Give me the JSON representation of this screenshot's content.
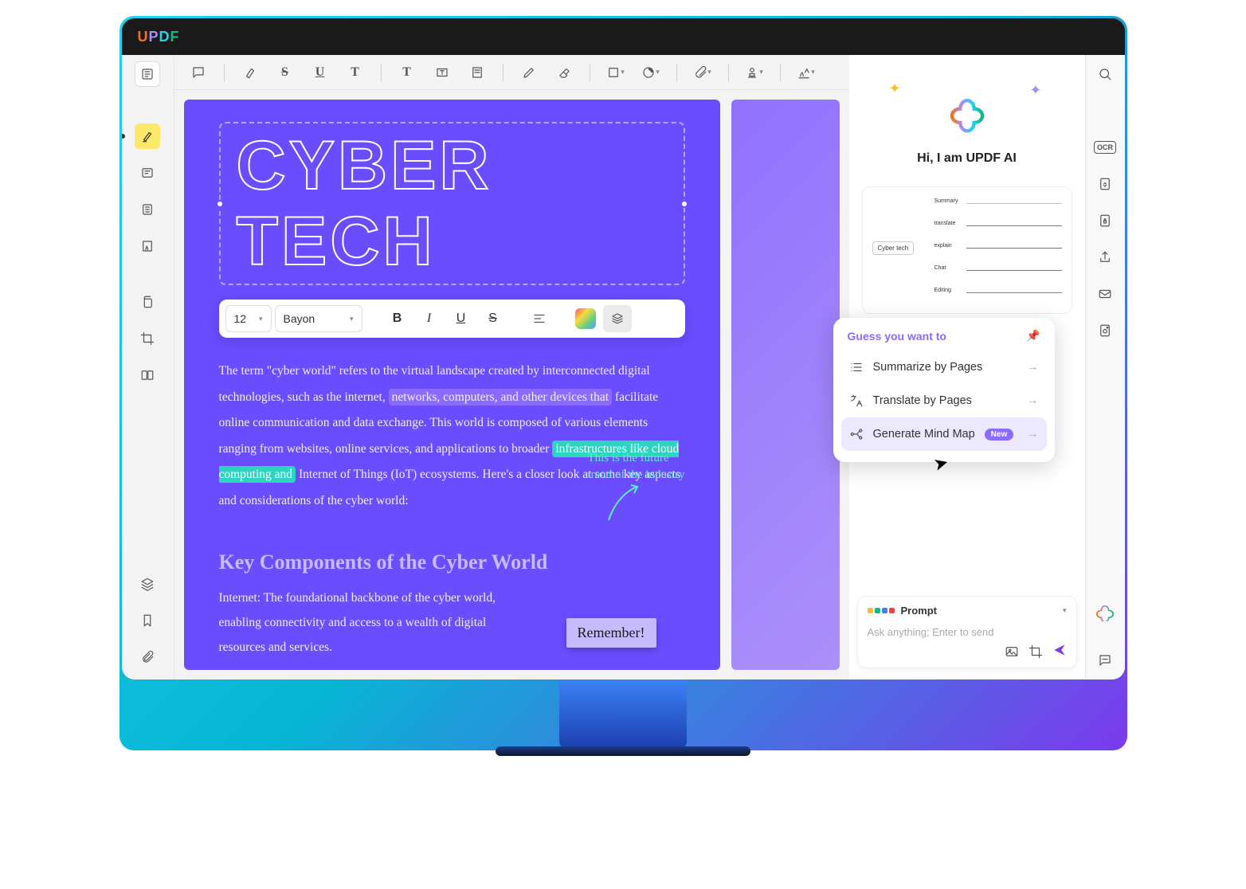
{
  "app_logo": "UPDF",
  "document": {
    "title": "CYBER TECH",
    "fontSize": "12",
    "fontName": "Bayon",
    "paragraph1_a": "The term \"cyber world\" refers to the virtual landscape created by interconnected digital technologies, such as the internet, ",
    "paragraph1_hl1": "networks, computers, and other devices that",
    "paragraph1_b": " facilitate online communication and data exchange. This world is composed of various elements ranging from websites, online services, and applications to broader ",
    "paragraph1_hl2": "infrastructures like cloud computing and",
    "paragraph1_c": " Internet of Things (IoT) ecosystems. Here's a closer look at some key aspects and considerations of the cyber world:",
    "annotation_l1": "This is the future",
    "annotation_l2": "trend of the industry",
    "subhead": "Key Components of the Cyber World",
    "sub_body": "Internet: The foundational backbone of the cyber world, enabling connectivity and access to a wealth of digital resources and services.",
    "sticky": "Remember!"
  },
  "ai": {
    "greeting": "Hi, I am UPDF AI",
    "mindmap_root": "Cyber tech",
    "mindmap_nodes": [
      "Summary",
      "translate",
      "explain",
      "Chat",
      "Editing"
    ],
    "suggest_title": "Guess you want to",
    "suggest_1": "Summarize by Pages",
    "suggest_2": "Translate by Pages",
    "suggest_3": "Generate Mind Map",
    "badge_new": "New",
    "prompt_label": "Prompt",
    "prompt_placeholder": "Ask anything; Enter to send"
  },
  "right_rail": {
    "ocr": "OCR"
  }
}
